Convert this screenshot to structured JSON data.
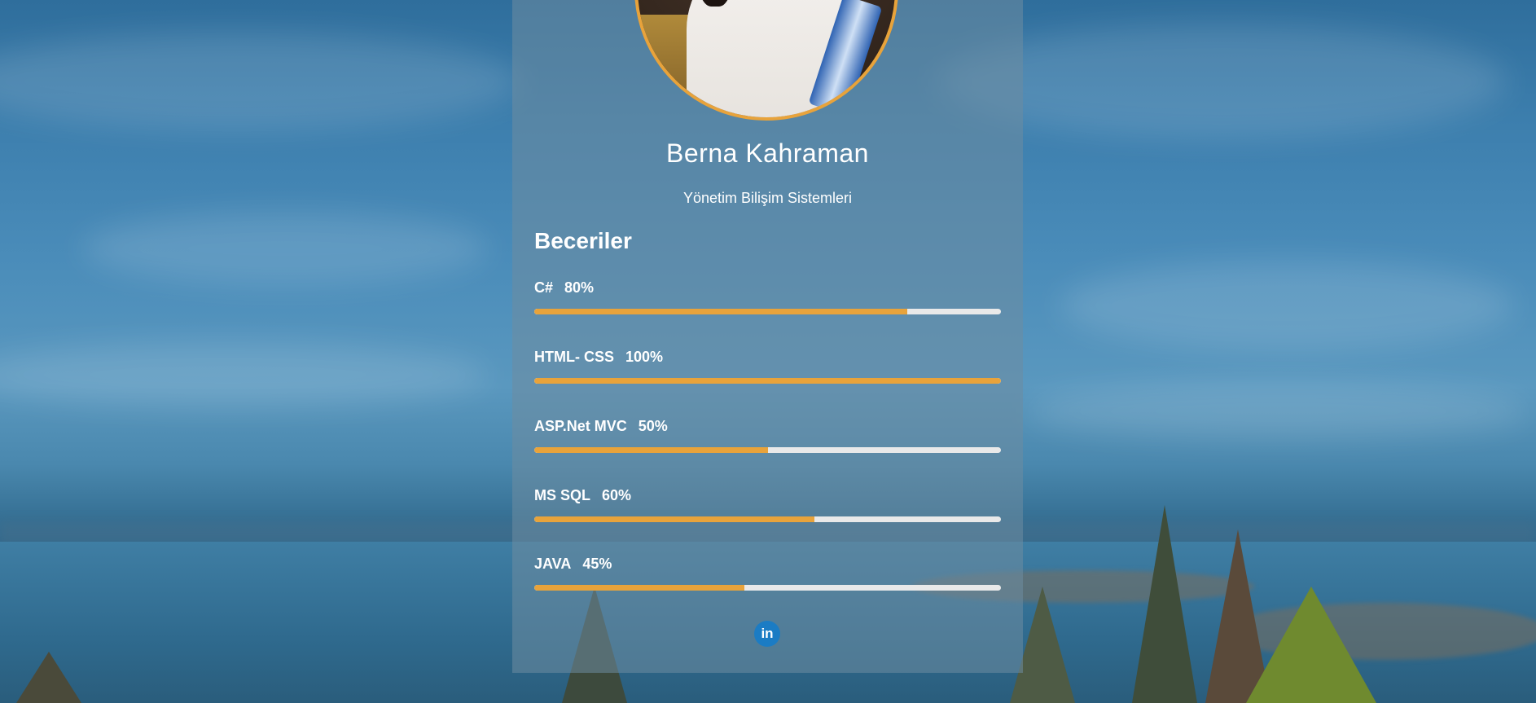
{
  "profile": {
    "name": "Berna Kahraman",
    "department": "Yönetim Bilişim Sistemleri",
    "avatar_border_color": "#e8a33b"
  },
  "skills": {
    "title": "Beceriler",
    "bar_color": "#e8a33b",
    "track_color": "#e9e9e9",
    "items": [
      {
        "name": "C#",
        "percent_label": "80%",
        "percent": 80
      },
      {
        "name": "HTML- CSS",
        "percent_label": "100%",
        "percent": 100
      },
      {
        "name": "ASP.Net MVC",
        "percent_label": "50%",
        "percent": 50
      },
      {
        "name": "MS SQL",
        "percent_label": "60%",
        "percent": 60
      },
      {
        "name": "JAVA",
        "percent_label": "45%",
        "percent": 45
      }
    ]
  },
  "social": {
    "linkedin_icon": "linkedin-icon",
    "linkedin_glyph": "in",
    "linkedin_color": "#1b7cc4"
  }
}
